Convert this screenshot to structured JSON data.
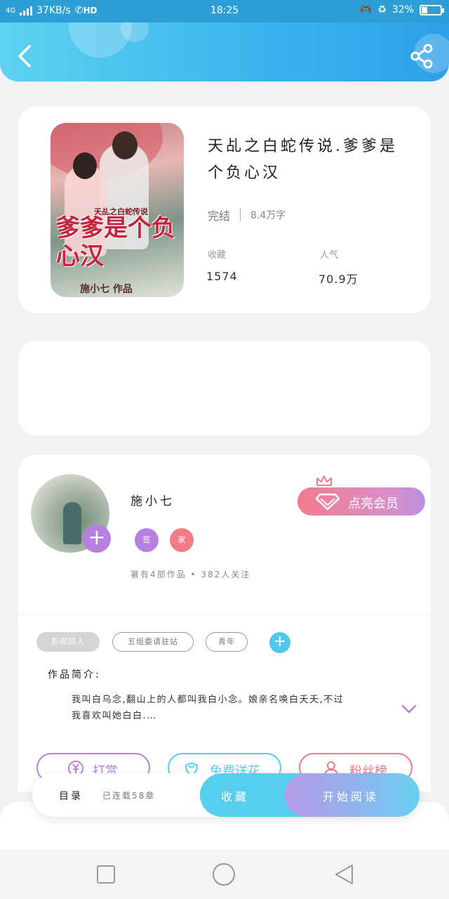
{
  "status_bar": {
    "network": "4G",
    "speed": "37KB/s",
    "hd": "HD",
    "time": "18:25",
    "battery": "32%"
  },
  "header": {
    "back_icon": "chevron-left-icon",
    "share_icon": "share-icon"
  },
  "book": {
    "title": "天乩之白蛇传说.爹爹是个负心汉",
    "status": "完结",
    "word_count": "8.4万字",
    "favorites_label": "收藏",
    "favorites_value": "1574",
    "popularity_label": "人气",
    "popularity_value": "70.9万",
    "cover": {
      "subtitle": "天乩之白蛇传说",
      "title": "爹爹是个负心汉",
      "author": "施小七 作品"
    }
  },
  "author": {
    "name": "施小七",
    "badges": [
      {
        "label": "签",
        "color": "#b780e0"
      },
      {
        "label": "家",
        "color": "#f27a84"
      }
    ],
    "stats": "著有4部作品 • 382人关注",
    "vip_label": "点亮会员"
  },
  "tags": [
    "影视同人",
    "五组委请驻站",
    "青年"
  ],
  "intro": {
    "label": "作品简介:",
    "text": "我叫白乌念,翻山上的人都叫我白小念。娘亲名唤白夭夭,不过我喜欢叫她白白.…"
  },
  "actions": {
    "reward": "打赏",
    "flowers": "免费送花",
    "fans": "粉丝榜"
  },
  "bottom_bar": {
    "toc": "目录",
    "serial": "已连载58章",
    "favorite": "收藏",
    "read": "开始阅读"
  },
  "colors": {
    "header_start": "#5fd1f0",
    "header_end": "#2e9fe8",
    "accent_blue": "#57cdf0",
    "accent_purple": "#b780e0",
    "accent_pink": "#f27a8c"
  }
}
